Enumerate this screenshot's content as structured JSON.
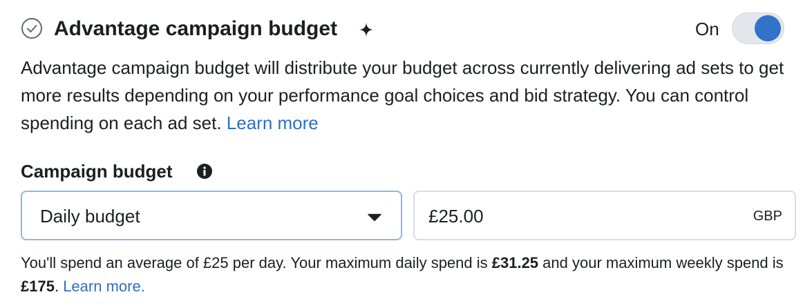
{
  "header": {
    "check_icon": "circle-check-icon",
    "title": "Advantage campaign budget",
    "sparkle_icon": "sparkle-icon",
    "toggle_label": "On",
    "toggle_on": true,
    "toggle_color": "#2f74c9"
  },
  "description": {
    "text": "Advantage campaign budget will distribute your budget across currently delivering ad sets to get more results depending on your performance goal choices and bid strategy. You can control spending on each ad set. ",
    "link": "Learn more"
  },
  "budget": {
    "label": "Campaign budget",
    "info_icon": "info-icon",
    "type_selected": "Daily budget",
    "amount": "£25.00",
    "currency": "GBP"
  },
  "note": {
    "part1": "You'll spend an average of £25 per day. Your maximum daily spend is ",
    "max_daily": "£31.25",
    "part2": " and your maximum weekly spend is ",
    "max_weekly": "£175",
    "part3": ". ",
    "link": "Learn more."
  },
  "colors": {
    "link": "#2f6fbf",
    "select_border": "#8fb5e8"
  }
}
